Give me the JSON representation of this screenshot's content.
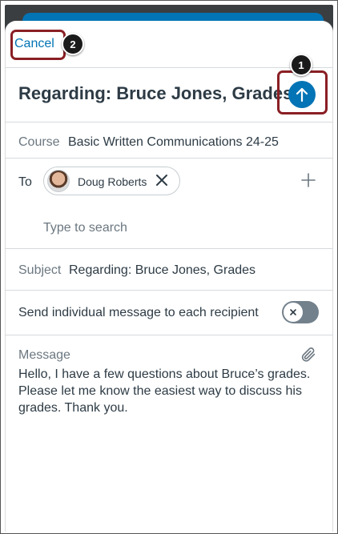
{
  "header": {
    "cancel_label": "Cancel",
    "title": "Regarding: Bruce Jones, Grades",
    "send_icon": "arrow-up-icon"
  },
  "callouts": [
    "1",
    "2"
  ],
  "course": {
    "label": "Course",
    "value": "Basic Written Communications 24-25"
  },
  "to": {
    "label": "To",
    "recipients": [
      {
        "name": "Doug Roberts"
      }
    ],
    "search_placeholder": "Type to search",
    "add_icon": "plus-icon"
  },
  "subject": {
    "label": "Subject",
    "value": "Regarding: Bruce Jones, Grades"
  },
  "individual": {
    "label": "Send individual message to each recipient",
    "enabled": false
  },
  "message": {
    "label": "Message",
    "body": "Hello, I have a few questions about Bruce’s grades. Please let me know the easiest way to discuss his grades. Thank you.",
    "attach_icon": "paperclip-icon"
  },
  "colors": {
    "accent": "#0374b5",
    "callout": "#8a1f24",
    "divider": "#d7dadd"
  }
}
